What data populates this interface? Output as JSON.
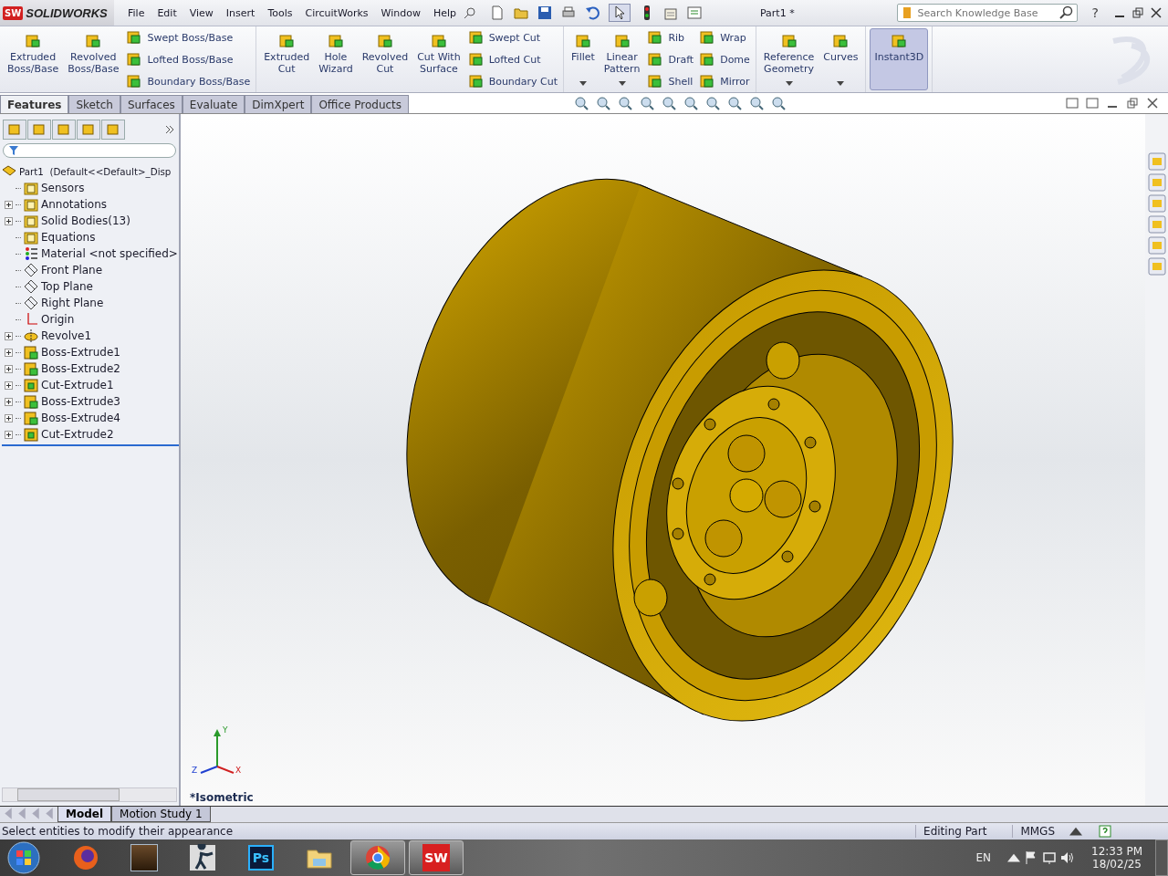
{
  "app": {
    "logo_badge": "SW",
    "logo": "SOLIDWORKS",
    "menu": [
      "File",
      "Edit",
      "View",
      "Insert",
      "Tools",
      "CircuitWorks",
      "Window",
      "Help"
    ],
    "document_title": "Part1 *",
    "search": {
      "placeholder": "Search Knowledge Base"
    },
    "help": "?"
  },
  "ribbon": {
    "groups": [
      [
        {
          "kind": "large",
          "label": "Extruded\nBoss/Base",
          "dropdown": false,
          "selected": false
        },
        {
          "kind": "large",
          "label": "Revolved\nBoss/Base",
          "dropdown": false,
          "selected": false
        },
        {
          "kind": "stack",
          "items": [
            "Swept Boss/Base",
            "Lofted Boss/Base",
            "Boundary Boss/Base"
          ]
        }
      ],
      [
        {
          "kind": "large",
          "label": "Extruded\nCut",
          "dropdown": false,
          "selected": false
        },
        {
          "kind": "large",
          "label": "Hole\nWizard",
          "dropdown": false,
          "selected": false
        },
        {
          "kind": "large",
          "label": "Revolved\nCut",
          "dropdown": false,
          "selected": false
        },
        {
          "kind": "large",
          "label": "Cut With\nSurface",
          "dropdown": false,
          "selected": false
        },
        {
          "kind": "stack",
          "items": [
            "Swept Cut",
            "Lofted Cut",
            "Boundary Cut"
          ]
        }
      ],
      [
        {
          "kind": "large",
          "label": "Fillet",
          "dropdown": true,
          "selected": false
        },
        {
          "kind": "large",
          "label": "Linear\nPattern",
          "dropdown": true,
          "selected": false
        },
        {
          "kind": "stack",
          "items": [
            "Rib",
            "Draft",
            "Shell"
          ]
        },
        {
          "kind": "stack",
          "items": [
            "Wrap",
            "Dome",
            "Mirror"
          ]
        }
      ],
      [
        {
          "kind": "large",
          "label": "Reference\nGeometry",
          "dropdown": true,
          "selected": false
        },
        {
          "kind": "large",
          "label": "Curves",
          "dropdown": true,
          "selected": false
        }
      ],
      [
        {
          "kind": "large",
          "label": "Instant3D",
          "dropdown": false,
          "selected": true
        }
      ]
    ]
  },
  "command_tabs": [
    {
      "label": "Features",
      "selected": true
    },
    {
      "label": "Sketch",
      "selected": false
    },
    {
      "label": "Surfaces",
      "selected": false
    },
    {
      "label": "Evaluate",
      "selected": false
    },
    {
      "label": "DimXpert",
      "selected": false
    },
    {
      "label": "Office Products",
      "selected": false
    }
  ],
  "feature_tree": {
    "root": {
      "label": "Part1  (Default<<Default>_Disp",
      "children": [
        {
          "label": "Sensors",
          "kind": "sensors",
          "expandable": false
        },
        {
          "label": "Annotations",
          "kind": "annotations",
          "expandable": true
        },
        {
          "label": "Solid Bodies(13)",
          "kind": "bodies",
          "expandable": true
        },
        {
          "label": "Equations",
          "kind": "equations",
          "expandable": false
        },
        {
          "label": "Material <not specified>",
          "kind": "material",
          "expandable": false
        },
        {
          "label": "Front Plane",
          "kind": "plane",
          "expandable": false
        },
        {
          "label": "Top Plane",
          "kind": "plane",
          "expandable": false
        },
        {
          "label": "Right Plane",
          "kind": "plane",
          "expandable": false
        },
        {
          "label": "Origin",
          "kind": "origin",
          "expandable": false
        },
        {
          "label": "Revolve1",
          "kind": "revolve",
          "expandable": true
        },
        {
          "label": "Boss-Extrude1",
          "kind": "boss",
          "expandable": true
        },
        {
          "label": "Boss-Extrude2",
          "kind": "boss",
          "expandable": true
        },
        {
          "label": "Cut-Extrude1",
          "kind": "cut",
          "expandable": true
        },
        {
          "label": "Boss-Extrude3",
          "kind": "boss",
          "expandable": true
        },
        {
          "label": "Boss-Extrude4",
          "kind": "boss",
          "expandable": true
        },
        {
          "label": "Cut-Extrude2",
          "kind": "cut",
          "expandable": true
        }
      ]
    }
  },
  "viewport": {
    "view_label": "*Isometric",
    "triad": {
      "y": "Y",
      "x": "X",
      "z": "Z"
    }
  },
  "bottom_tabs": [
    {
      "label": "Model",
      "selected": true
    },
    {
      "label": "Motion Study 1",
      "selected": false
    }
  ],
  "status_bar": {
    "message": "Select entities to modify their appearance",
    "mode": "Editing Part",
    "units": "MMGS"
  },
  "taskbar": {
    "apps": [
      {
        "kind": "firefox",
        "active": false
      },
      {
        "kind": "game",
        "active": false
      },
      {
        "kind": "soldier",
        "active": false
      },
      {
        "kind": "photoshop",
        "label": "Ps",
        "active": false
      },
      {
        "kind": "explorer",
        "active": false
      },
      {
        "kind": "chrome",
        "active": true
      },
      {
        "kind": "solidworks",
        "label": "SW",
        "active": true
      }
    ],
    "language": "EN",
    "time": "12:33 PM",
    "date": "18/02/25"
  }
}
